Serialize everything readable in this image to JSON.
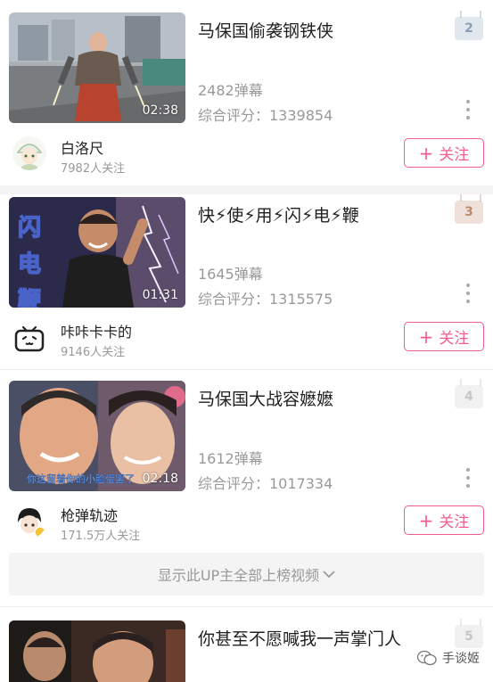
{
  "colors": {
    "accent": "#f25d8e",
    "rank_blue": "#8a9db5",
    "rank_bronze": "#b98c72",
    "rank_gray": "#c6c6c6"
  },
  "items": [
    {
      "rank": "2",
      "title": "马保国偷袭钢铁侠",
      "duration": "02:38",
      "danmaku": "2482弹幕",
      "score": "综合评分：1339854",
      "uploader": "白洛尺",
      "fans": "7982人关注",
      "follow_label": "关注",
      "more_icon": "more-vertical-icon"
    },
    {
      "rank": "3",
      "title": "快⚡使⚡用⚡闪⚡电⚡鞭",
      "duration": "01:31",
      "thumb_text": [
        "闪",
        "电",
        "鞭"
      ],
      "danmaku": "1645弹幕",
      "score": "综合评分：1315575",
      "uploader": "咔咔卡卡的",
      "fans": "9146人关注",
      "follow_label": "关注",
      "more_icon": "more-vertical-icon"
    },
    {
      "rank": "4",
      "title": "马保国大战容嬷嬷",
      "duration": "02:18",
      "thumb_caption": "你这留着你的小脸蛋罢了",
      "danmaku": "1612弹幕",
      "score": "综合评分：1017334",
      "uploader": "枪弹轨迹",
      "fans": "171.5万人关注",
      "follow_label": "关注",
      "more_icon": "more-vertical-icon"
    },
    {
      "rank": "5",
      "title": "你甚至不愿喊我一声掌门人"
    }
  ],
  "show_all": {
    "label": "显示此UP主全部上榜视频",
    "icon": "chevron-down-icon"
  },
  "watermark": {
    "label": "手谈姬",
    "icon": "wechat-icon"
  }
}
